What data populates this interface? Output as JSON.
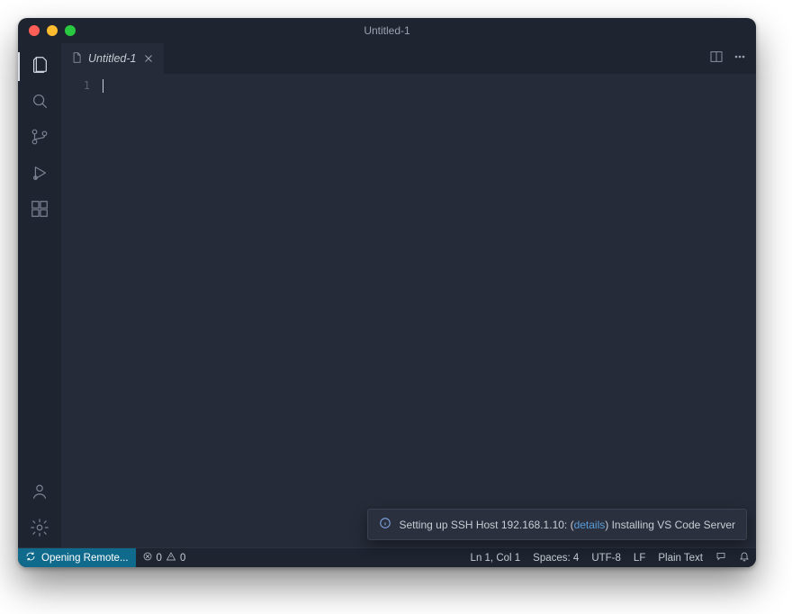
{
  "window": {
    "title": "Untitled-1"
  },
  "tabs": [
    {
      "label": "Untitled-1"
    }
  ],
  "editor": {
    "line_numbers": [
      "1"
    ]
  },
  "toast": {
    "prefix": "Setting up SSH Host 192.168.1.10: (",
    "link": "details",
    "suffix": ") Installing VS Code Server"
  },
  "statusbar": {
    "remote": "Opening Remote...",
    "errors": "0",
    "warnings": "0",
    "cursor": "Ln 1, Col 1",
    "spaces": "Spaces: 4",
    "encoding": "UTF-8",
    "eol": "LF",
    "language": "Plain Text"
  }
}
